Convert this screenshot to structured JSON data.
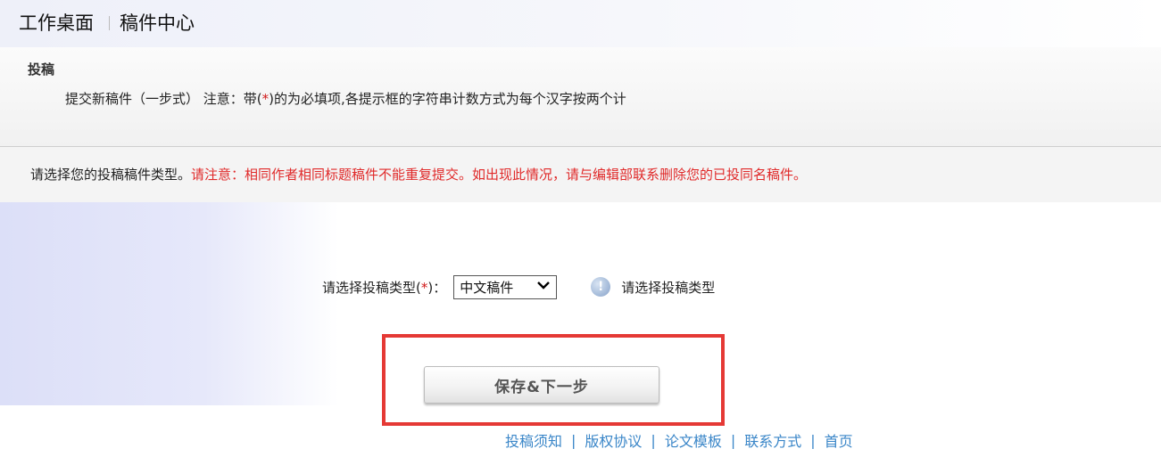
{
  "breadcrumb": {
    "home": "工作桌面",
    "current": "稿件中心"
  },
  "info_panel": {
    "title": "投稿",
    "line_prefix": "提交新稿件（一步式） 注意：带(",
    "required_mark": "*",
    "line_suffix": ")的为必填项,各提示框的字符串计数方式为每个汉字按两个计"
  },
  "notice": {
    "prompt": "请选择您的投稿稿件类型。",
    "warning": "请注意：相同作者相同标题稿件不能重复提交。如出现此情况，请与编辑部联系删除您的已投同名稿件。"
  },
  "form": {
    "type_label_prefix": "请选择投稿类型(",
    "required_mark": "*",
    "type_label_suffix": ")：",
    "type_value": "中文稿件",
    "help_icon_glyph": "!",
    "help_text": "请选择投稿类型"
  },
  "save_button_label": "保存&下一步",
  "footer": {
    "links": [
      "投稿须知",
      "版权协议",
      "论文模板",
      "联系方式",
      "首页"
    ],
    "separator": "|"
  },
  "colors": {
    "warning_text": "#e02a2a",
    "link": "#3a86c8",
    "highlight_border": "#e53935"
  }
}
